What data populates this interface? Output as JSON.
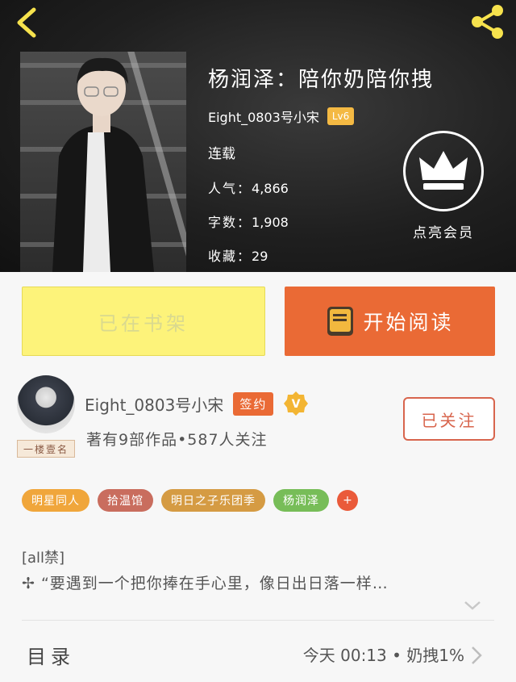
{
  "book": {
    "title": "杨润泽：陪你奶陪你拽",
    "author": "Eight_0803号小宋",
    "author_level": "Lv6",
    "status": "连载",
    "stats": [
      {
        "label": "人气：",
        "value": "4,866"
      },
      {
        "label": "字数：",
        "value": "1,908"
      },
      {
        "label": "收藏：",
        "value": "29"
      }
    ],
    "vip_label": "点亮会员"
  },
  "actions": {
    "shelf_label": "已在书架",
    "read_label": "开始阅读"
  },
  "writer": {
    "name": "Eight_0803号小宋",
    "signed_badge": "签约",
    "verified_mark": "V",
    "avatar_tag": "一楼壹名",
    "stats": "著有9部作品•587人关注",
    "follow_label": "已关注"
  },
  "tags": [
    {
      "label": "明星同人",
      "color": "#f0a63b"
    },
    {
      "label": "拾温馆",
      "color": "#c96d5e"
    },
    {
      "label": "明日之子乐团季",
      "color": "#d59b43"
    },
    {
      "label": "杨润泽",
      "color": "#77bd58"
    }
  ],
  "tag_add": "+",
  "intro": {
    "line1": "[all禁]",
    "line2": " “要遇到一个把你捧在手心里，像日出日落一样…"
  },
  "catalog": {
    "label": "目录",
    "latest": "今天 00:13 • 奶拽1%"
  },
  "colors": {
    "accent": "#ea6a35",
    "shelf_button": "#fdf37a",
    "back_icon": "#f6e24d"
  }
}
